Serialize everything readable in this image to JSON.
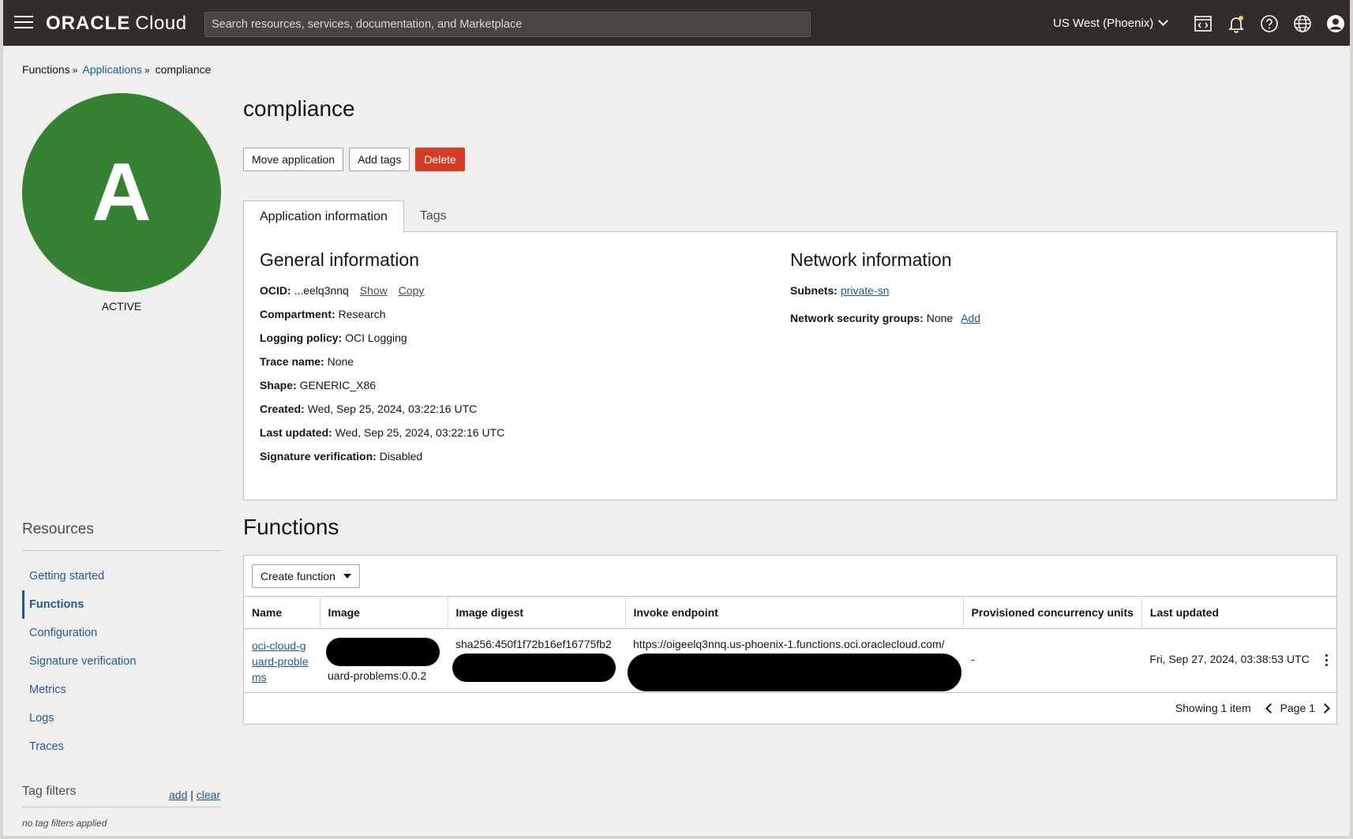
{
  "header": {
    "brand_bold": "ORACLE",
    "brand_rest": "Cloud",
    "search_placeholder": "Search resources, services, documentation, and Marketplace",
    "region": "US West (Phoenix)"
  },
  "breadcrumb": {
    "item1": "Functions",
    "item2": "Applications",
    "item3": "compliance",
    "sep": "»"
  },
  "app": {
    "avatar_letter": "A",
    "status": "ACTIVE",
    "title": "compliance"
  },
  "actions": {
    "move": "Move application",
    "tags": "Add tags",
    "delete": "Delete"
  },
  "tabs": {
    "info": "Application information",
    "tags": "Tags"
  },
  "general": {
    "title": "General information",
    "ocid_label": "OCID:",
    "ocid_value": "...eelq3nnq",
    "show": "Show",
    "copy": "Copy",
    "compartment_label": "Compartment:",
    "compartment_value": "Research",
    "logging_label": "Logging policy:",
    "logging_value": "OCI Logging",
    "trace_label": "Trace name:",
    "trace_value": "None",
    "shape_label": "Shape:",
    "shape_value": "GENERIC_X86",
    "created_label": "Created:",
    "created_value": "Wed, Sep 25, 2024, 03:22:16 UTC",
    "updated_label": "Last updated:",
    "updated_value": "Wed, Sep 25, 2024, 03:22:16 UTC",
    "sigver_label": "Signature verification:",
    "sigver_value": "Disabled"
  },
  "network": {
    "title": "Network information",
    "subnets_label": "Subnets:",
    "subnets_value": "private-sn",
    "nsg_label": "Network security groups:",
    "nsg_value": "None",
    "nsg_add": "Add"
  },
  "functions": {
    "title": "Functions",
    "create_label": "Create function",
    "columns": [
      "Name",
      "Image",
      "Image digest",
      "Invoke endpoint",
      "Provisioned concurrency units",
      "Last updated"
    ],
    "rows": [
      {
        "name": "oci-cloud-guard-problems",
        "image": "uard-problems:0.0.2",
        "digest": "sha256:450f1f72b16ef16775fb2",
        "endpoint": "https://oigeelq3nnq.us-phoenix-1.functions.oci.oraclecloud.com/",
        "pcu": "-",
        "updated": "Fri, Sep 27, 2024, 03:38:53 UTC"
      }
    ],
    "showing": "Showing 1 item",
    "page": "Page 1"
  },
  "sidebar": {
    "resources_title": "Resources",
    "items": [
      "Getting started",
      "Functions",
      "Configuration",
      "Signature verification",
      "Metrics",
      "Logs",
      "Traces"
    ],
    "tag_filters_title": "Tag filters",
    "tag_add": "add",
    "tag_divider": "|",
    "tag_clear": "clear",
    "tag_none": "no tag filters applied"
  }
}
